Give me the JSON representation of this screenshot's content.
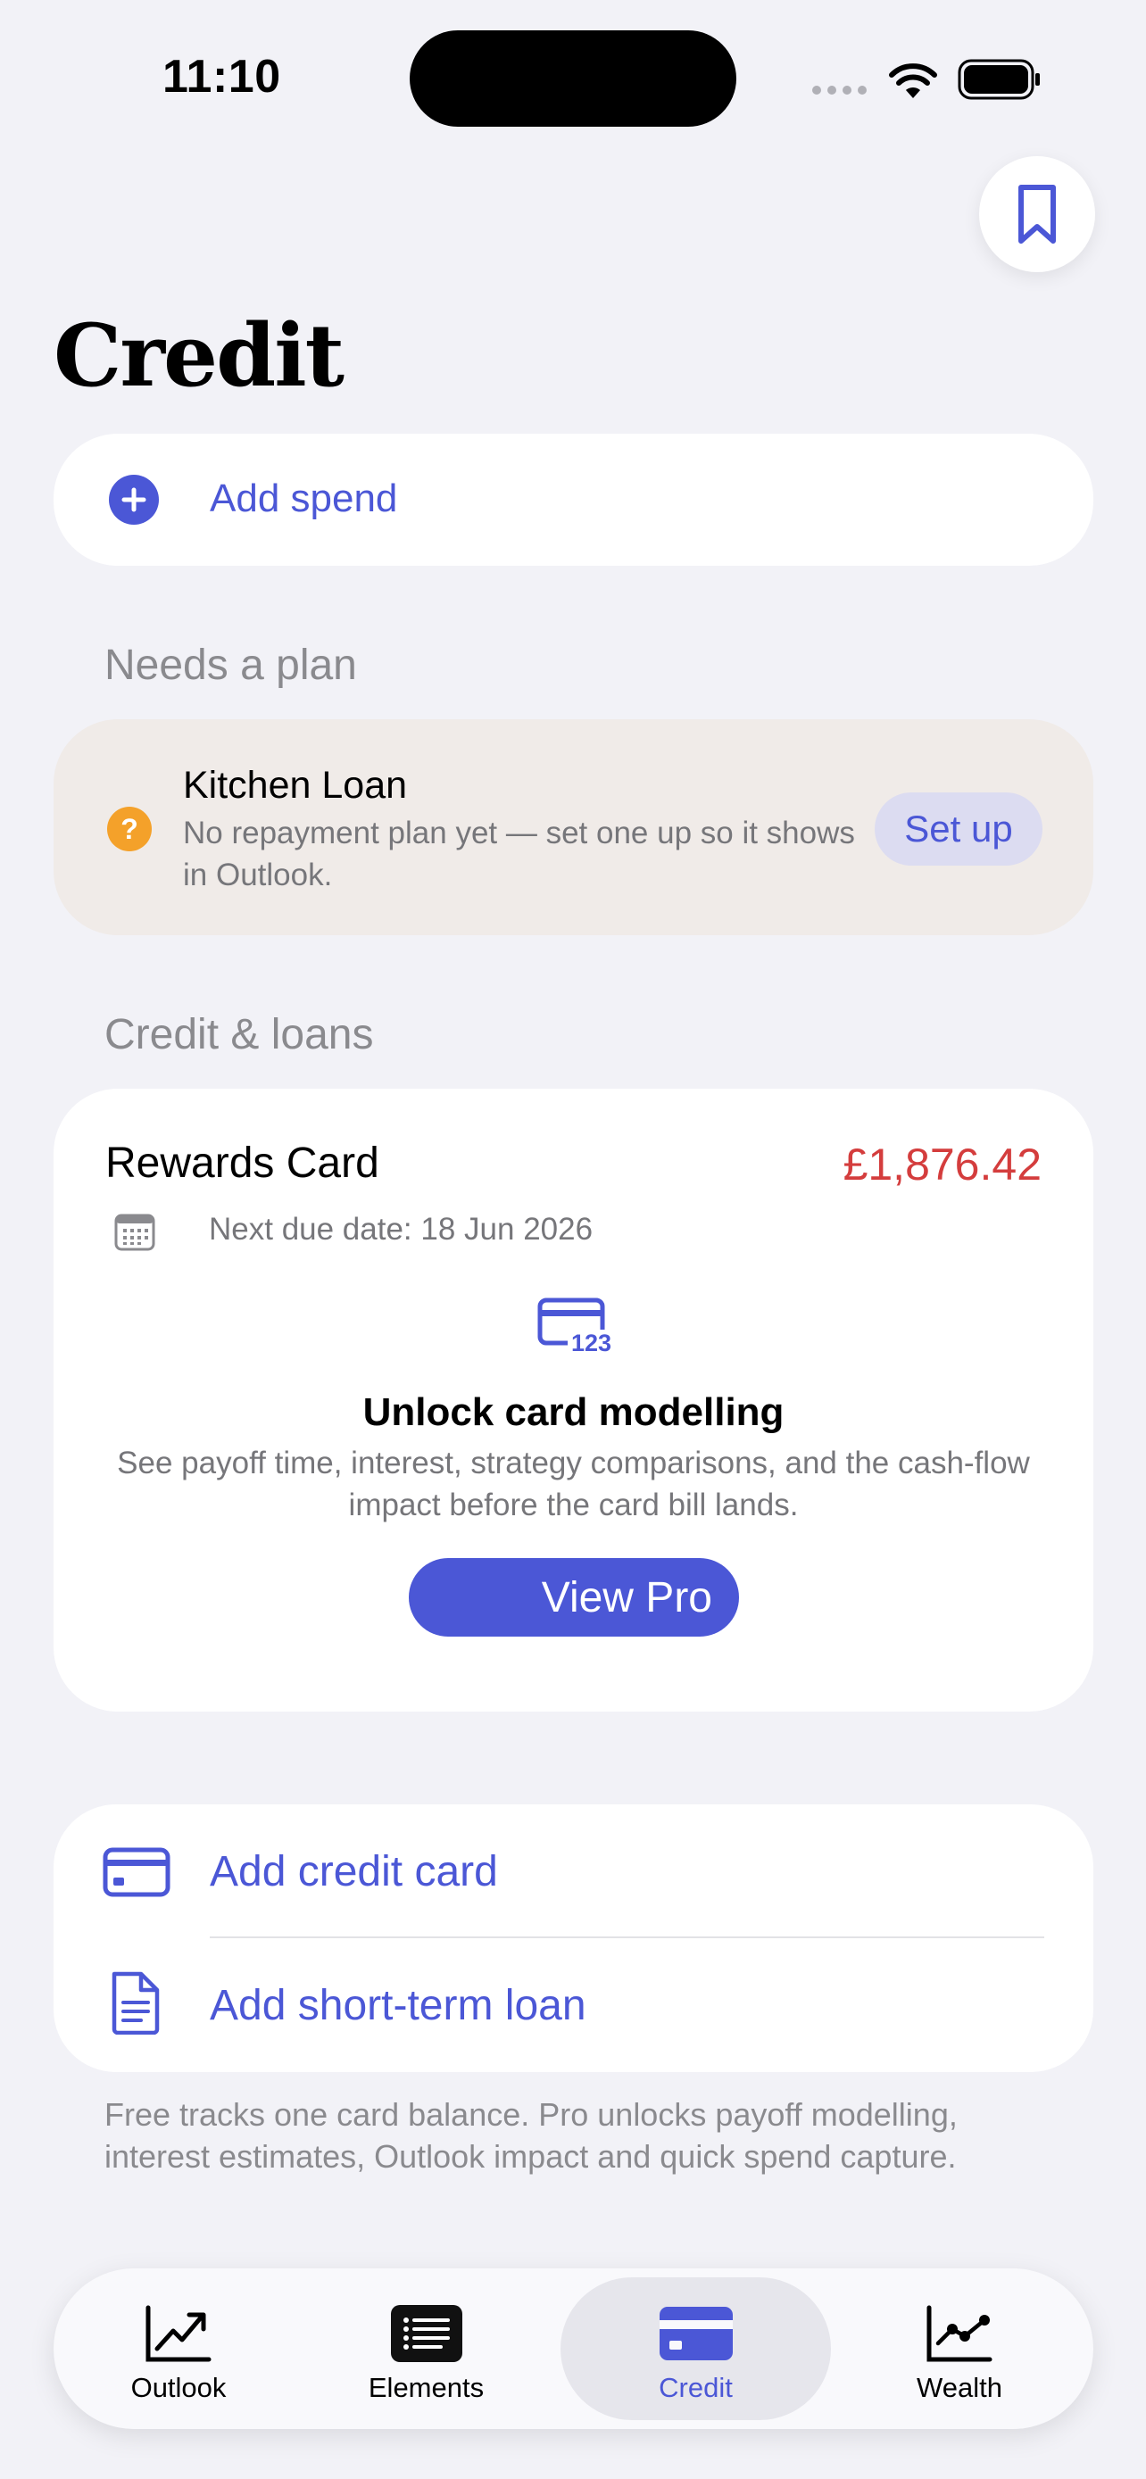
{
  "status_bar": {
    "time": "11:10",
    "icons": [
      "signal-dots-icon",
      "wifi-icon",
      "battery-icon"
    ]
  },
  "header": {
    "bookmark_icon": "bookmark-icon",
    "title": "Credit"
  },
  "add_spend": {
    "icon": "plus-circle-icon",
    "label": "Add spend"
  },
  "needs_plan": {
    "section_title": "Needs a plan",
    "item": {
      "icon": "question-icon",
      "icon_glyph": "?",
      "title": "Kitchen Loan",
      "description": "No repayment plan yet — set one up so it shows in Outlook.",
      "action_label": "Set up"
    }
  },
  "credit_loans": {
    "section_title": "Credit & loans",
    "card": {
      "name": "Rewards Card",
      "balance": "£1,876.42",
      "due_icon": "calendar-icon",
      "due_text": "Next due date: 18 Jun 2026",
      "promo_icon": "card-123-icon",
      "promo_title": "Unlock card modelling",
      "promo_description": "See payoff time, interest, strategy comparisons, and the cash-flow impact before the card bill lands.",
      "promo_button": "View Pro"
    }
  },
  "add_actions": [
    {
      "icon": "credit-card-icon",
      "label": "Add credit card"
    },
    {
      "icon": "document-icon",
      "label": "Add short-term loan"
    }
  ],
  "footnote": "Free tracks one card balance. Pro unlocks payoff modelling, interest estimates, Outlook impact and quick spend capture.",
  "tabs": [
    {
      "icon": "trend-up-icon",
      "label": "Outlook",
      "active": false
    },
    {
      "icon": "list-icon",
      "label": "Elements",
      "active": false
    },
    {
      "icon": "credit-card-icon",
      "label": "Credit",
      "active": true
    },
    {
      "icon": "line-chart-icon",
      "label": "Wealth",
      "active": false
    }
  ],
  "colors": {
    "accent": "#4b57d6",
    "negative": "#d43d3d",
    "warning": "#f4a12a",
    "background": "#f2f2f7"
  }
}
